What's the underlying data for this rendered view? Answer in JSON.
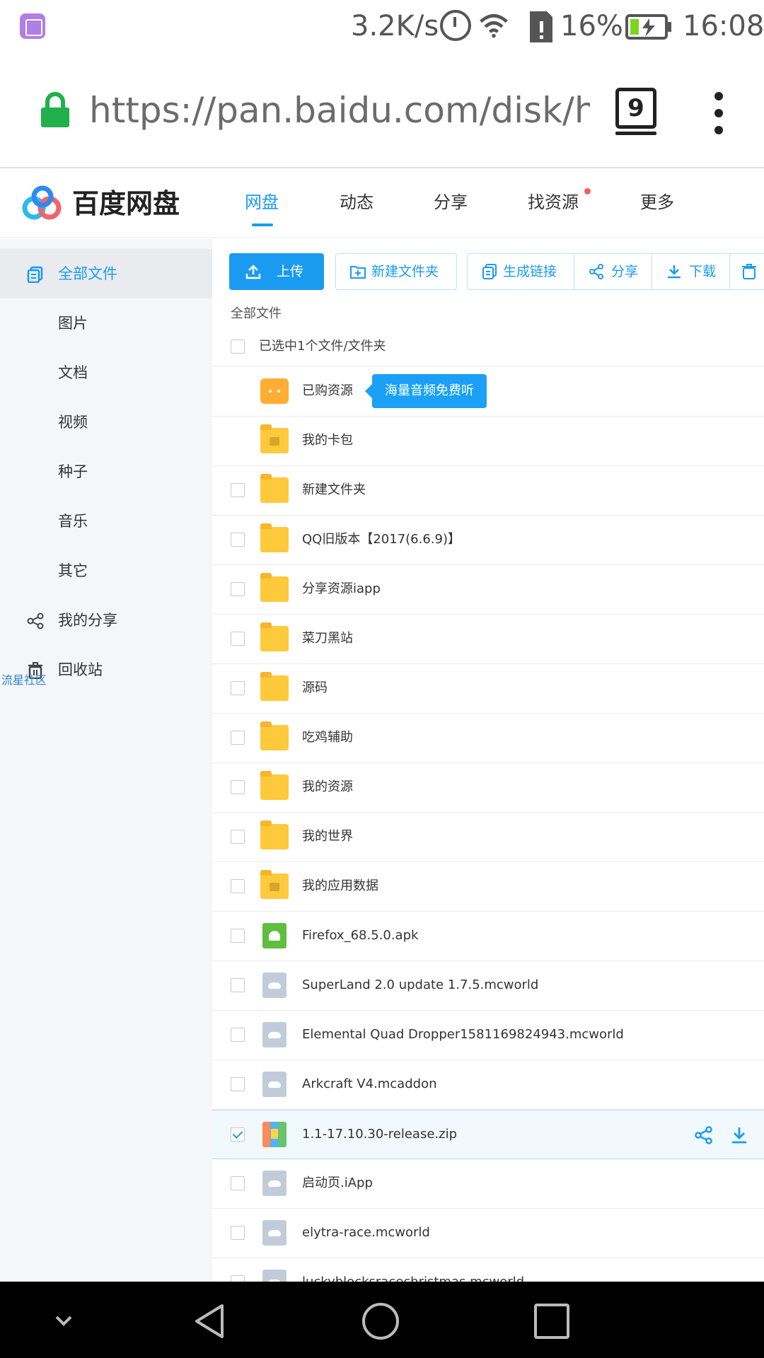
{
  "status_bar": {
    "net_speed": "3.2K/s",
    "battery_percent": "16%",
    "time": "16:08"
  },
  "browser": {
    "url": "https://pan.baidu.com/disk/home",
    "tab_count": "9"
  },
  "app": {
    "logo_text": "百度网盘",
    "nav": [
      {
        "label": "网盘"
      },
      {
        "label": "动态"
      },
      {
        "label": "分享"
      },
      {
        "label": "找资源"
      },
      {
        "label": "更多"
      }
    ],
    "accent_color": "#1a9bf0"
  },
  "sidebar": {
    "items": [
      {
        "label": "全部文件"
      },
      {
        "label": "图片"
      },
      {
        "label": "文档"
      },
      {
        "label": "视频"
      },
      {
        "label": "种子"
      },
      {
        "label": "音乐"
      },
      {
        "label": "其它"
      },
      {
        "label": "我的分享"
      },
      {
        "label": "回收站"
      }
    ],
    "watermark": "流星社区"
  },
  "toolbar": {
    "upload": "上传",
    "new_folder": "新建文件夹",
    "gen_link": "生成链接",
    "share": "分享",
    "download": "下载"
  },
  "breadcrumb": "全部文件",
  "select_status": "已选中1个文件/文件夹",
  "promo_tooltip": "海量音频免费听",
  "files": [
    {
      "name": "已购资源",
      "icon": "shopping-bag-icon"
    },
    {
      "name": "我的卡包",
      "icon": "wallet-folder-icon"
    },
    {
      "name": "新建文件夹",
      "icon": "folder-icon"
    },
    {
      "name": "QQ旧版本【2017(6.6.9)】",
      "icon": "folder-icon"
    },
    {
      "name": "分享资源iapp",
      "icon": "folder-icon"
    },
    {
      "name": "菜刀黑站",
      "icon": "folder-icon"
    },
    {
      "name": "源码",
      "icon": "folder-icon"
    },
    {
      "name": "吃鸡辅助",
      "icon": "folder-icon"
    },
    {
      "name": "我的资源",
      "icon": "folder-icon"
    },
    {
      "name": "我的世界",
      "icon": "folder-icon"
    },
    {
      "name": "我的应用数据",
      "icon": "app-data-folder-icon"
    },
    {
      "name": "Firefox_68.5.0.apk",
      "icon": "android-apk-icon"
    },
    {
      "name": "SuperLand 2.0 update 1.7.5.mcworld",
      "icon": "cloud-file-icon"
    },
    {
      "name": "Elemental Quad Dropper1581169824943.mcworld",
      "icon": "cloud-file-icon"
    },
    {
      "name": "Arkcraft V4.mcaddon",
      "icon": "cloud-file-icon"
    },
    {
      "name": "1.1-17.10.30-release.zip",
      "icon": "zip-archive-icon",
      "selected": true
    },
    {
      "name": "启动页.iApp",
      "icon": "cloud-file-icon"
    },
    {
      "name": "elytra-race.mcworld",
      "icon": "cloud-file-icon"
    },
    {
      "name": "luckyblocksracechristmas.mcworld",
      "icon": "cloud-file-icon"
    }
  ]
}
